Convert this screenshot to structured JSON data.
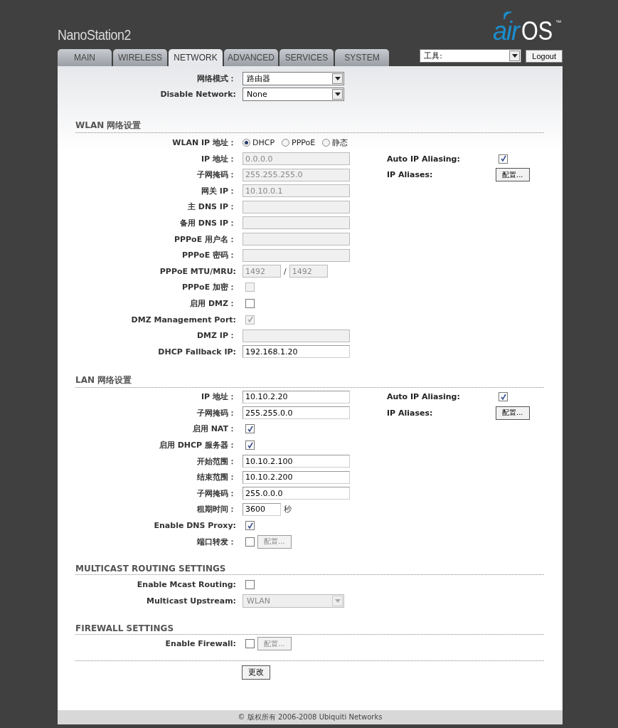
{
  "header": {
    "device": "NanoStation2",
    "logo": {
      "part1": "air",
      "part2": "OS",
      "mark": "™"
    },
    "tabs": [
      {
        "label": "MAIN",
        "selected": false
      },
      {
        "label": "WIRELESS",
        "selected": false
      },
      {
        "label": "NETWORK",
        "selected": true
      },
      {
        "label": "ADVANCED",
        "selected": false
      },
      {
        "label": "SERVICES",
        "selected": false
      },
      {
        "label": "SYSTEM",
        "selected": false
      }
    ],
    "tools": {
      "value": "工具:"
    },
    "logout": "Logout"
  },
  "top_rows": [
    {
      "kind": "select",
      "label": "网络模式：",
      "value": "路由器",
      "disabled": false
    },
    {
      "kind": "select",
      "label": "Disable Network:",
      "value": "None",
      "disabled": false
    }
  ],
  "sections": [
    {
      "title": "WLAN 网络设置",
      "rows": [
        {
          "kind": "radio",
          "label": "WLAN IP 地址：",
          "options": [
            {
              "label": "DHCP",
              "selected": true
            },
            {
              "label": "PPPoE",
              "selected": false
            },
            {
              "label": "静态",
              "selected": false
            }
          ]
        },
        {
          "kind": "text",
          "label": "IP 地址：",
          "value": "0.0.0.0",
          "disabled": true,
          "side": {
            "kind": "checkbox",
            "label": "Auto IP Aliasing:",
            "checked": true
          }
        },
        {
          "kind": "text",
          "label": "子网掩码：",
          "value": "255.255.255.0",
          "disabled": true,
          "side": {
            "kind": "button",
            "label": "IP Aliases:",
            "button": "配置..."
          }
        },
        {
          "kind": "text",
          "label": "网关 IP：",
          "value": "10.10.0.1",
          "disabled": true
        },
        {
          "kind": "text",
          "label": "主 DNS IP：",
          "value": "",
          "disabled": true
        },
        {
          "kind": "text",
          "label": "备用 DNS IP：",
          "value": "",
          "disabled": true
        },
        {
          "kind": "text",
          "label": "PPPoE 用户名：",
          "value": "",
          "disabled": true
        },
        {
          "kind": "text",
          "label": "PPPoE 密码：",
          "value": "",
          "disabled": true
        },
        {
          "kind": "pair",
          "label": "PPPoE MTU/MRU:",
          "values": [
            "1492",
            "1492"
          ],
          "separator": "/",
          "disabled": true
        },
        {
          "kind": "checkbox",
          "label": "PPPoE 加密：",
          "checked": false,
          "disabled": true
        },
        {
          "kind": "checkbox",
          "label": "启用 DMZ：",
          "checked": false,
          "disabled": false
        },
        {
          "kind": "checkbox",
          "label": "DMZ Management Port:",
          "checked": true,
          "disabled": true
        },
        {
          "kind": "text",
          "label": "DMZ IP：",
          "value": "",
          "disabled": true
        },
        {
          "kind": "text",
          "label": "DHCP Fallback IP:",
          "value": "192.168.1.20",
          "disabled": false
        }
      ]
    },
    {
      "title": "LAN 网络设置",
      "rows": [
        {
          "kind": "text",
          "label": "IP 地址：",
          "value": "10.10.2.20",
          "disabled": false,
          "side": {
            "kind": "checkbox",
            "label": "Auto IP Aliasing:",
            "checked": true
          }
        },
        {
          "kind": "text",
          "label": "子网掩码：",
          "value": "255.255.0.0",
          "disabled": false,
          "side": {
            "kind": "button",
            "label": "IP Aliases:",
            "button": "配置..."
          }
        },
        {
          "kind": "checkbox",
          "label": "启用 NAT：",
          "checked": true,
          "disabled": false
        },
        {
          "kind": "checkbox",
          "label": "启用 DHCP 服务器：",
          "checked": true,
          "disabled": false
        },
        {
          "kind": "text",
          "label": "开始范围：",
          "value": "10.10.2.100",
          "disabled": false
        },
        {
          "kind": "text",
          "label": "结束范围：",
          "value": "10.10.2.200",
          "disabled": false
        },
        {
          "kind": "text",
          "label": "子网掩码：",
          "value": "255.0.0.0",
          "disabled": false
        },
        {
          "kind": "number_unit",
          "label": "租期时间：",
          "value": "3600",
          "unit": "秒"
        },
        {
          "kind": "checkbox",
          "label": "Enable DNS Proxy:",
          "checked": true,
          "disabled": false
        },
        {
          "kind": "checkbox_button",
          "label": "端口转发：",
          "checked": false,
          "button": "配置...",
          "button_disabled": true
        }
      ]
    },
    {
      "title": "MULTICAST ROUTING SETTINGS",
      "rows": [
        {
          "kind": "checkbox",
          "label": "Enable Mcast Routing:",
          "checked": false,
          "disabled": false
        },
        {
          "kind": "select",
          "label": "Multicast Upstream:",
          "value": "WLAN",
          "disabled": true
        }
      ]
    },
    {
      "title": "FIREWALL SETTINGS",
      "rows": [
        {
          "kind": "checkbox_button",
          "label": "Enable Firewall:",
          "checked": false,
          "button": "配置...",
          "button_disabled": true
        }
      ]
    }
  ],
  "submit": "更改",
  "footer": "© 版权所有 2006-2008 Ubiquiti Networks"
}
